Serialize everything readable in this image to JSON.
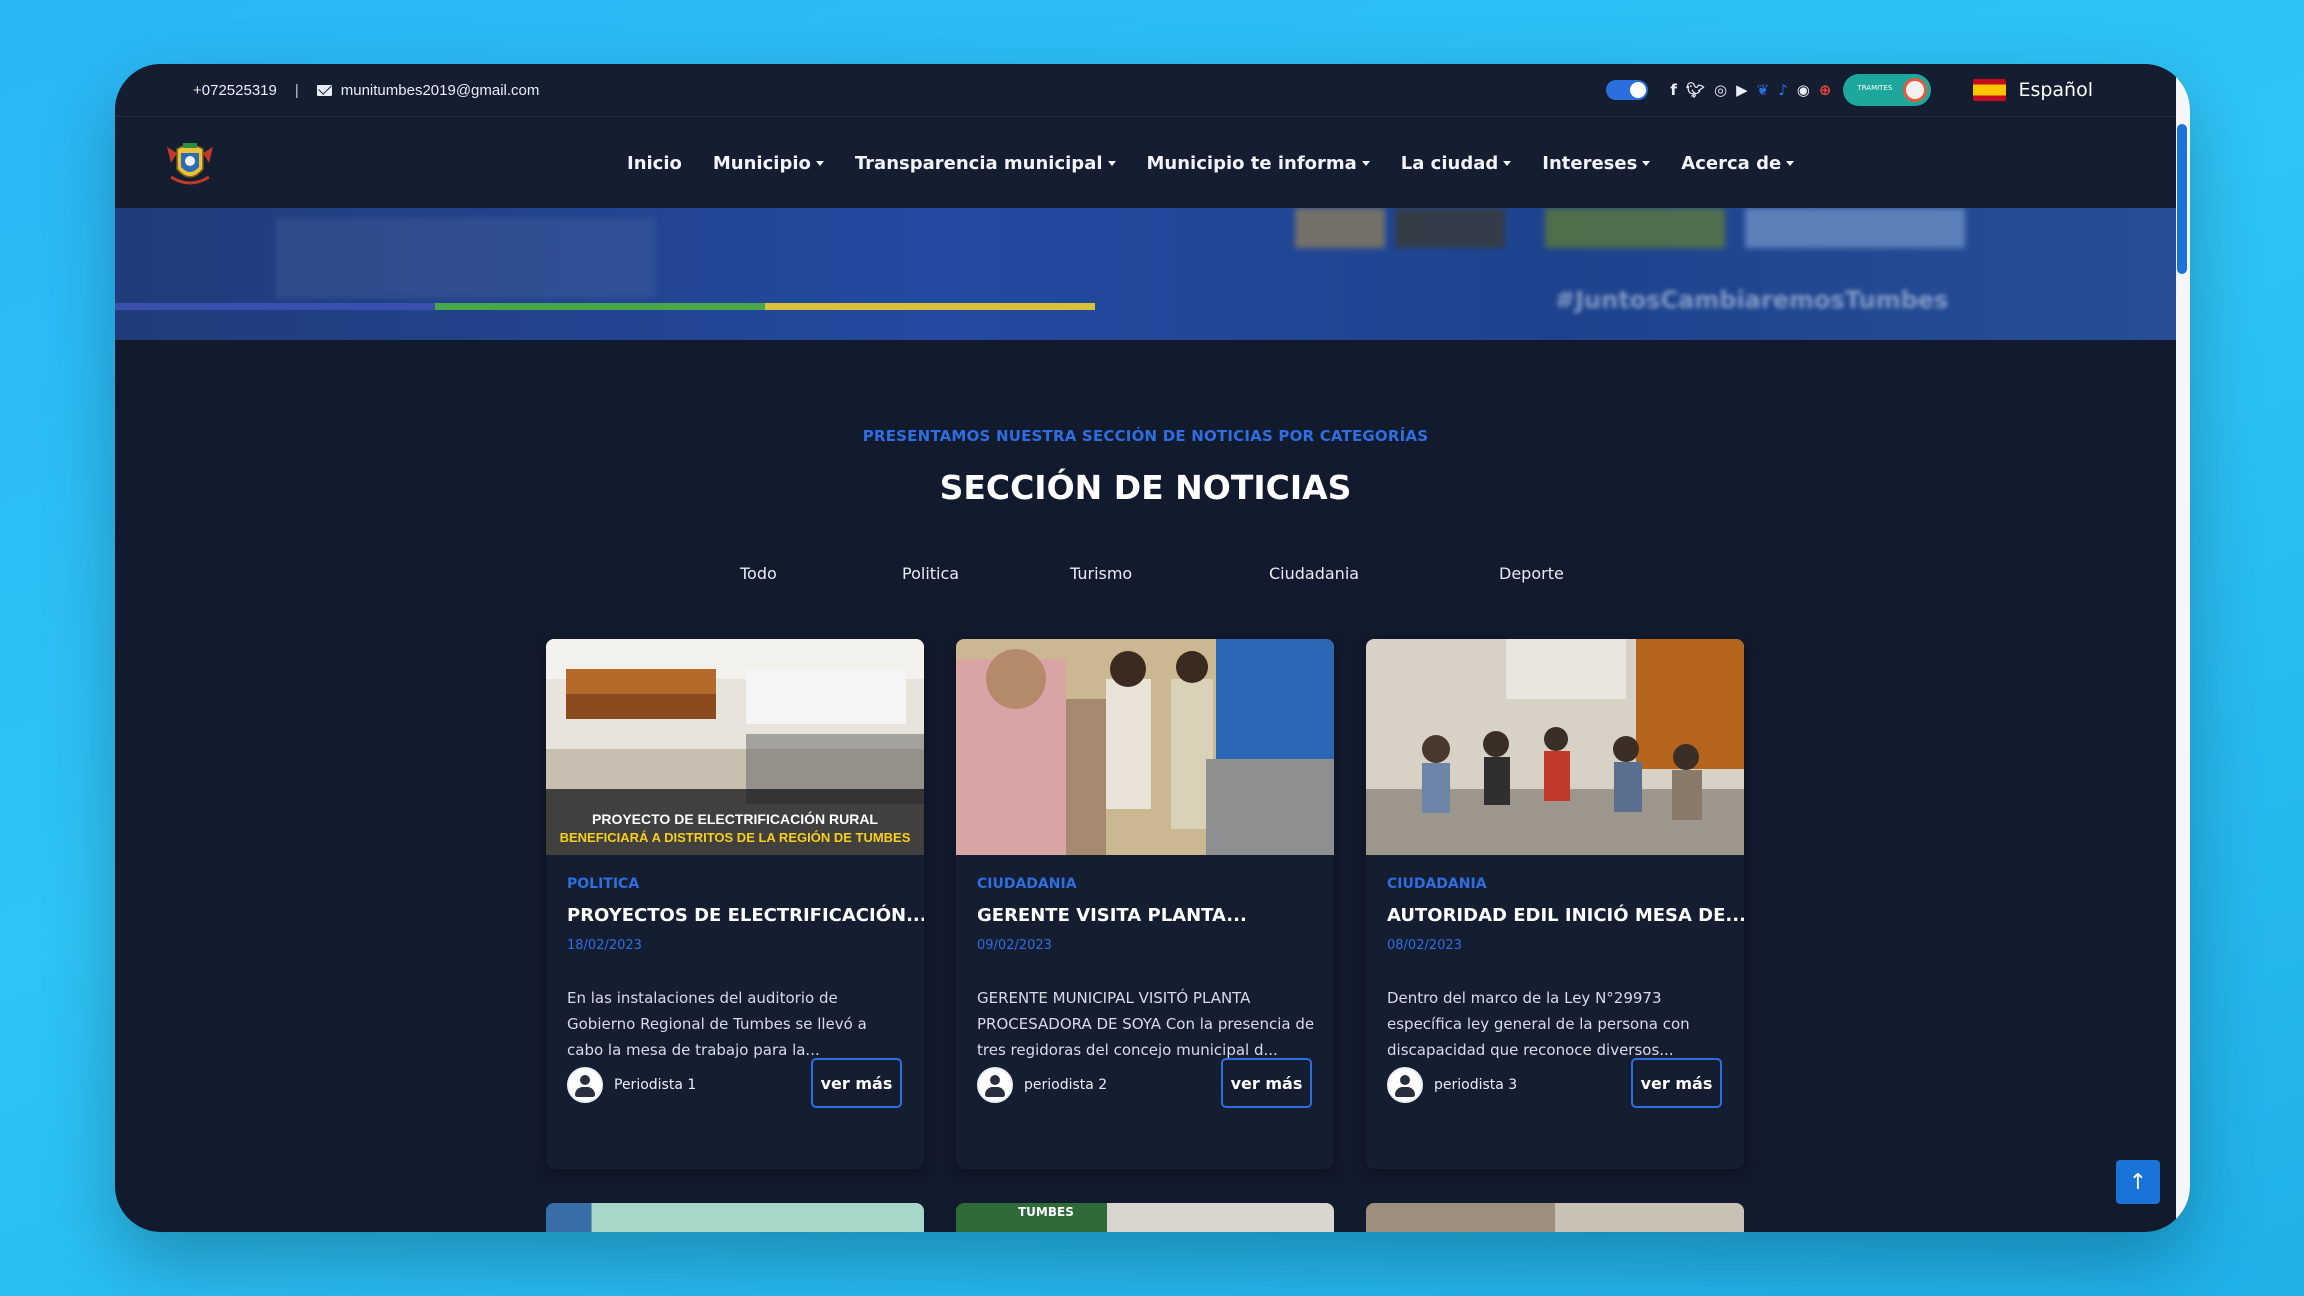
{
  "topbar": {
    "phone": "+072525319",
    "separator": "|",
    "email": "munitumbes2019@gmail.com",
    "social_icons": [
      "facebook-icon",
      "twitter-icon",
      "instagram-icon",
      "youtube-icon",
      "butterfly-icon",
      "tiktok-icon",
      "portal-icon",
      "cp-icon"
    ],
    "tramites_label": "TRAMITES",
    "language": "Español"
  },
  "nav": {
    "items": [
      {
        "label": "Inicio",
        "dropdown": false
      },
      {
        "label": "Municipio",
        "dropdown": true
      },
      {
        "label": "Transparencia municipal",
        "dropdown": true
      },
      {
        "label": "Municipio te informa",
        "dropdown": true
      },
      {
        "label": "La ciudad",
        "dropdown": true
      },
      {
        "label": "Intereses",
        "dropdown": true
      },
      {
        "label": "Acerca de",
        "dropdown": true
      }
    ]
  },
  "banner": {
    "hashtag": "#JuntosCambiaremosTumbes"
  },
  "section": {
    "kicker": "PRESENTAMOS NUESTRA SECCIÓN DE NOTICIAS POR CATEGORÍAS",
    "title": "SECCIÓN DE NOTICIAS",
    "filters": [
      "Todo",
      "Politica",
      "Turismo",
      "Ciudadania",
      "Deporte"
    ]
  },
  "cards": [
    {
      "image_caption_1": "PROYECTO DE ELECTRIFICACIÓN RURAL",
      "image_caption_2": "BENEFICIARÁ A DISTRITOS DE LA REGIÓN DE TUMBES",
      "category": "POLITICA",
      "title": "PROYECTOS DE ELECTRIFICACIÓN...",
      "date": "18/02/2023",
      "excerpt": "En las instalaciones del auditorio de Gobierno Regional de Tumbes se llevó a cabo la mesa de trabajo para la...",
      "author": "Periodista 1",
      "button": "ver más"
    },
    {
      "category": "CIUDADANIA",
      "title": "GERENTE VISITA PLANTA...",
      "date": "09/02/2023",
      "excerpt": "GERENTE MUNICIPAL VISITÓ PLANTA PROCESADORA DE SOYA Con la presencia de tres regidoras del concejo municipal d...",
      "author": "periodista 2",
      "button": "ver más"
    },
    {
      "category": "CIUDADANIA",
      "title": "AUTORIDAD EDIL INICIÓ MESA DE...",
      "date": "08/02/2023",
      "excerpt": "Dentro del marco de la Ley N°29973 específica ley general de la persona con discapacidad que reconoce diversos...",
      "author": "periodista 3",
      "button": "ver más"
    }
  ],
  "peek": {
    "label": "TUMBES"
  },
  "colors": {
    "background": "#29b6f6",
    "page": "#121a2d",
    "accent": "#2f6ee0"
  },
  "back_to_top_icon": "arrow-up-icon"
}
